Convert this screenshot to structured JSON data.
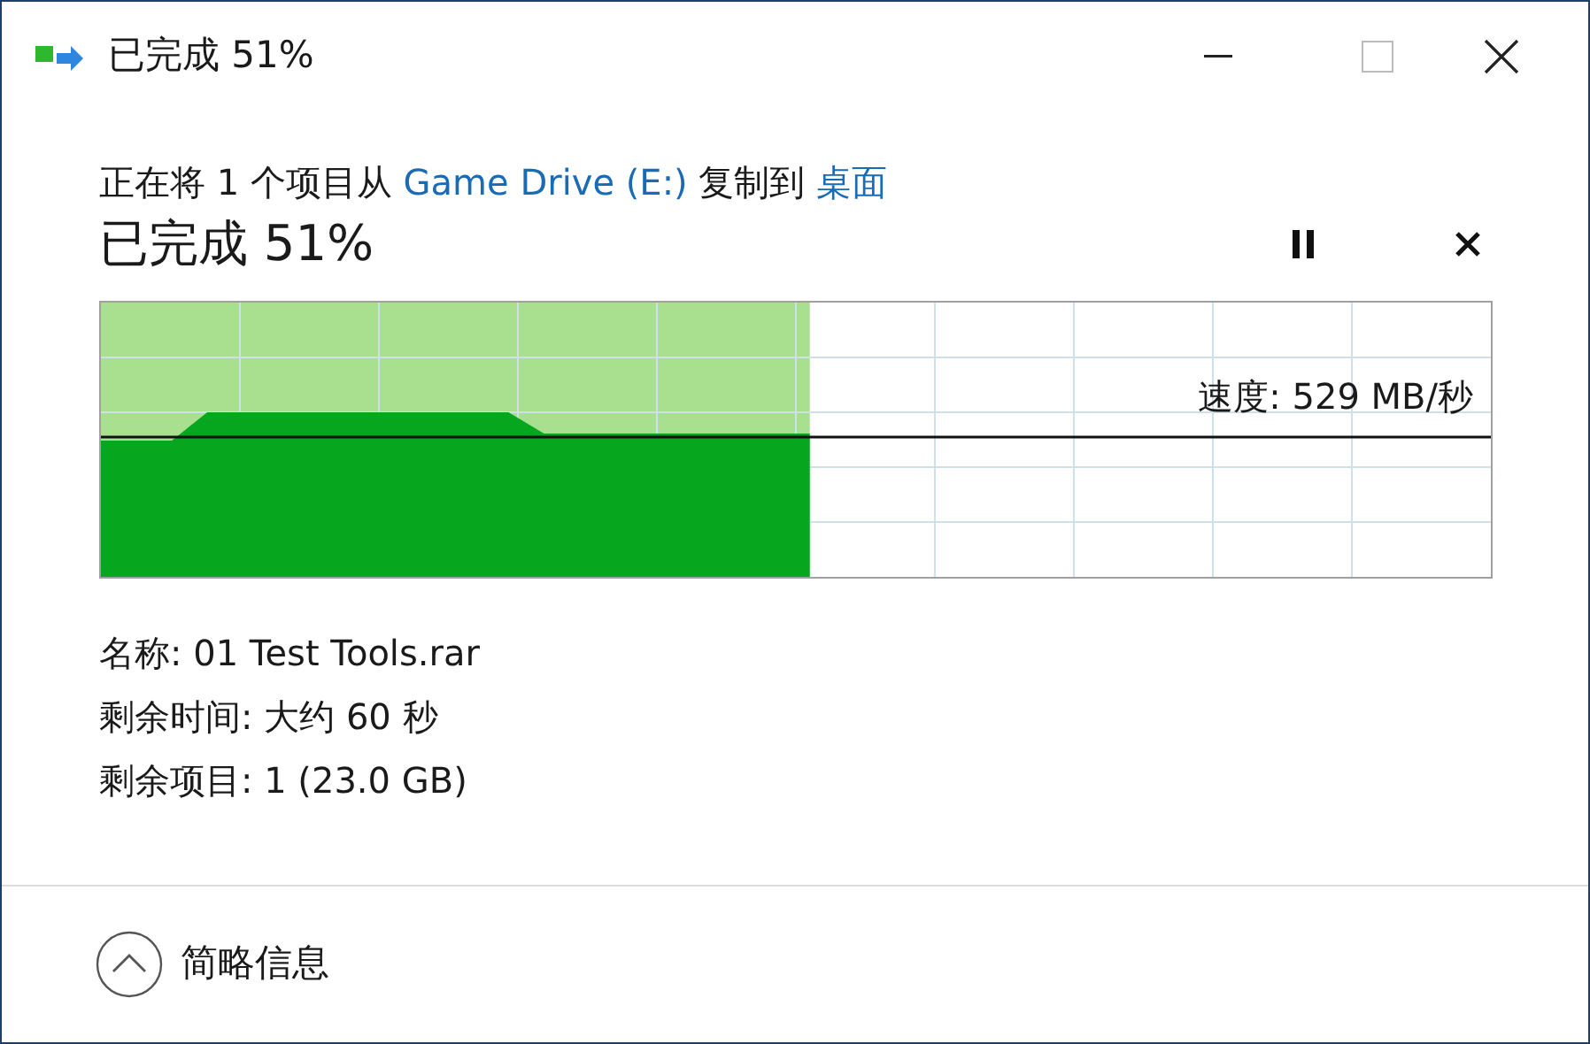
{
  "window": {
    "title": "已完成 51%"
  },
  "description": [
    {
      "kind": "text",
      "text": "正在将 1 个项目从 "
    },
    {
      "kind": "link",
      "text": "Game Drive (E:)"
    },
    {
      "kind": "text",
      "text": " 复制到 "
    },
    {
      "kind": "link",
      "text": "桌面"
    }
  ],
  "status": "已完成 51%",
  "graph": {
    "level": 0.51,
    "speed": "速度: 529 MB/秒"
  },
  "details": [
    "名称: 01 Test Tools.rar",
    "剩余时间: 大约 60 秒",
    "剩余项目: 1 (23.0 GB)"
  ],
  "footer": {
    "toggle": "简略信息",
    "expanded": true
  }
}
